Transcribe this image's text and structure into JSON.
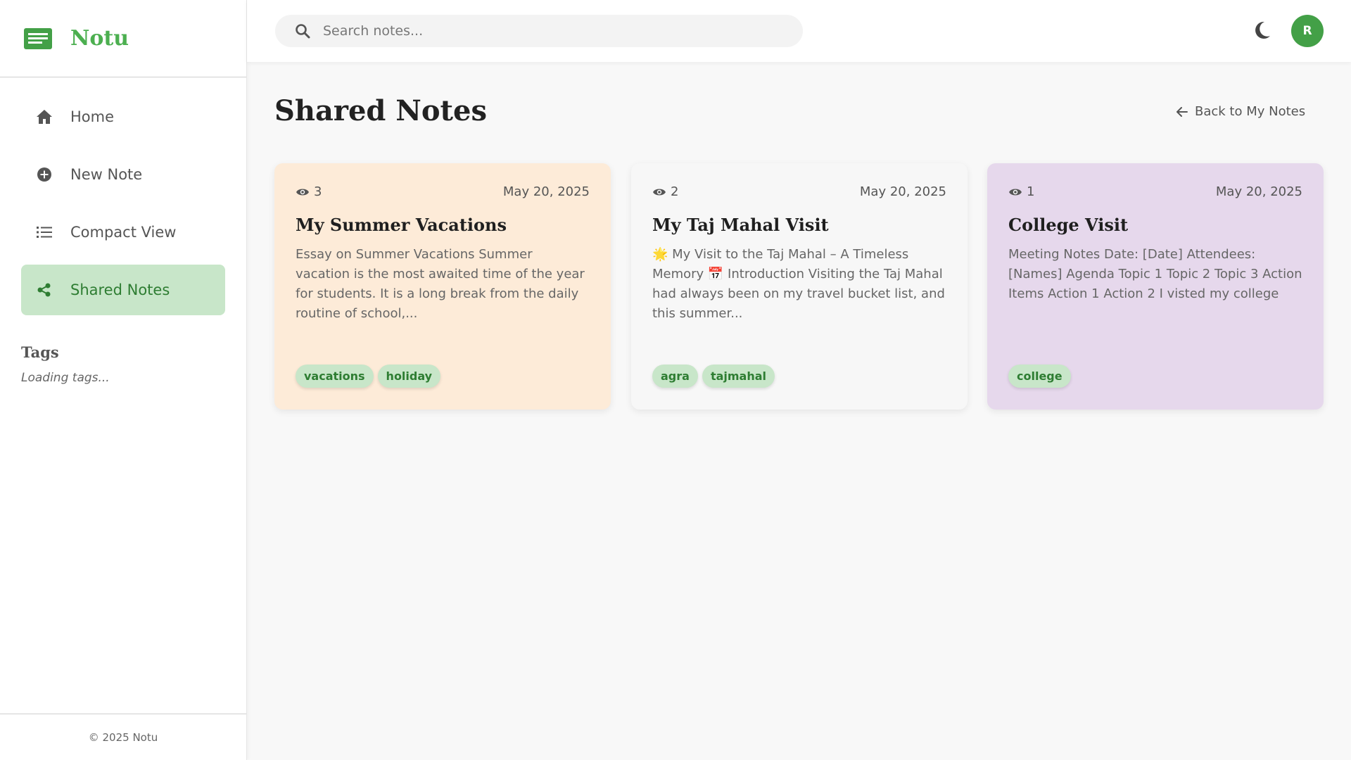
{
  "app": {
    "name": "Notu"
  },
  "sidebar": {
    "items": [
      {
        "label": "Home",
        "icon": "home-icon"
      },
      {
        "label": "New Note",
        "icon": "plus-circle-icon"
      },
      {
        "label": "Compact View",
        "icon": "list-icon"
      },
      {
        "label": "Shared Notes",
        "icon": "share-icon",
        "active": true
      }
    ],
    "tags_title": "Tags",
    "tags_loading": "Loading tags...",
    "footer": "© 2025 Notu"
  },
  "header": {
    "search_placeholder": "Search notes...",
    "avatar_initial": "R"
  },
  "main": {
    "title": "Shared Notes",
    "back_label": "Back to My Notes",
    "notes": [
      {
        "views": "3",
        "date": "May 20, 2025",
        "title": "My Summer Vacations",
        "excerpt": "Essay on Summer Vacations Summer vacation is the most awaited time of the year for students. It is a long break from the daily routine of school,...",
        "tags": [
          "vacations",
          "holiday"
        ],
        "color": "#fdebd8"
      },
      {
        "views": "2",
        "date": "May 20, 2025",
        "title": "My Taj Mahal Visit",
        "excerpt": "🌟 My Visit to the Taj Mahal – A Timeless Memory 📅 Introduction Visiting the Taj Mahal had always been on my travel bucket list, and this summer...",
        "tags": [
          "agra",
          "tajmahal"
        ],
        "color": "#f7f7f7"
      },
      {
        "views": "1",
        "date": "May 20, 2025",
        "title": "College Visit",
        "excerpt": "Meeting Notes Date: [Date] Attendees: [Names] Agenda Topic 1 Topic 2 Topic 3 Action Items Action 1 Action 2 I visted my college",
        "tags": [
          "college"
        ],
        "color": "#e6d8ec"
      }
    ]
  },
  "colors": {
    "accent": "#4caf50",
    "active_bg": "#c8e6c9",
    "tag_text": "#2e7d32"
  }
}
